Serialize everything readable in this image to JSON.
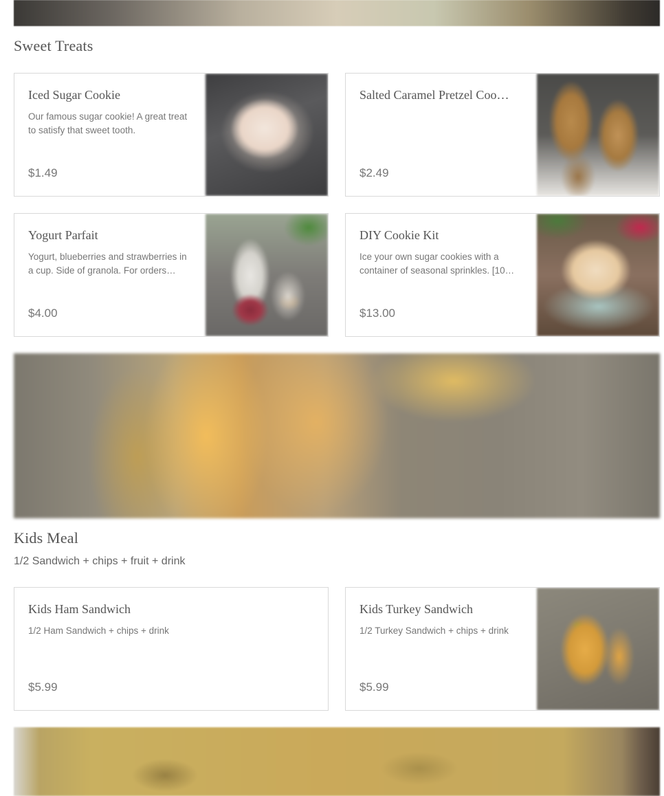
{
  "sections": [
    {
      "title": "Sweet Treats",
      "subtitle": "",
      "items": [
        {
          "name": "Iced Sugar Cookie",
          "description": "Our famous sugar cookie! A great treat to satisfy that sweet tooth.",
          "price": "$1.49"
        },
        {
          "name": "Salted Caramel Pretzel Coo…",
          "description": "",
          "price": "$2.49"
        },
        {
          "name": "Yogurt Parfait",
          "description": "Yogurt, blueberries and strawberries in a cup. Side of granola. For orders more…",
          "price": "$4.00"
        },
        {
          "name": "DIY Cookie Kit",
          "description": "Ice your own sugar cookies with a container of seasonal sprinkles. [10…",
          "price": "$13.00"
        }
      ]
    },
    {
      "title": "Kids Meal",
      "subtitle": "1/2 Sandwich + chips + fruit + drink",
      "items": [
        {
          "name": "Kids Ham Sandwich",
          "description": "1/2 Ham Sandwich + chips + drink",
          "price": "$5.99"
        },
        {
          "name": "Kids Turkey Sandwich",
          "description": "1/2 Turkey Sandwich + chips + drink",
          "price": "$5.99"
        }
      ]
    }
  ]
}
